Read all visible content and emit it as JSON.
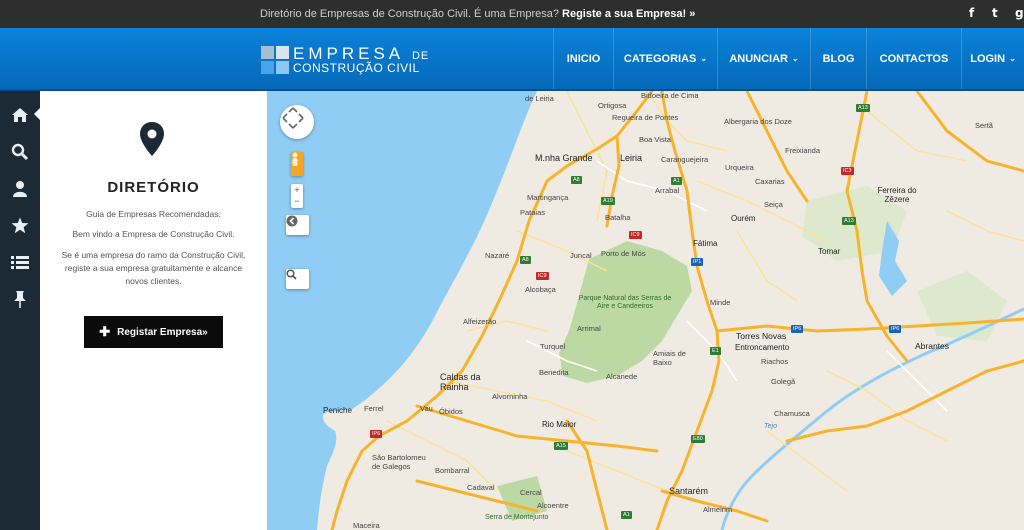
{
  "topbar": {
    "message": "Diretório de Empresas de Construção Civil.  É uma Empresa?",
    "cta": "Registe a sua Empresa! »",
    "social": {
      "facebook": "f",
      "twitter": "t",
      "google": "g"
    }
  },
  "logo": {
    "line1": "EMPRESA",
    "line1_small": "DE",
    "line2": "CONSTRUÇÃO CIVIL",
    "colors": [
      "#9fb6cc",
      "#6fb0e6",
      "#3a8fd8",
      "#d9e4ee"
    ]
  },
  "nav": [
    {
      "label": "INICIO",
      "chevron": false
    },
    {
      "label": "CATEGORIAS",
      "chevron": true
    },
    {
      "label": "ANUNCIAR",
      "chevron": true
    },
    {
      "label": "BLOG",
      "chevron": false
    },
    {
      "label": "CONTACTOS",
      "chevron": false
    },
    {
      "label": "LOGIN",
      "chevron": true
    }
  ],
  "sidebar_icons": [
    "home-icon",
    "search-icon",
    "user-icon",
    "star-icon",
    "list-icon",
    "pin-icon"
  ],
  "panel": {
    "title": "DIRETÓRIO",
    "p1": "Guia de Empresas Recomendadas.",
    "p2": "Bem vindo a Empresa de Construção Civil.",
    "p3": "Se é uma empresa do ramo da Construção Civil, registe a sua empresa gratuitamente e alcance novos clientes.",
    "button": "Registar Empresa»"
  },
  "map": {
    "zoom_in": "+",
    "zoom_out": "−",
    "labels": {
      "leiria_top": "de Leiria",
      "ortigosa": "Ortigosa",
      "regueira": "Regueira de Pontes",
      "boavista": "Boa Vista",
      "bidoeira": "Bidoeira de Cima",
      "albergaria": "Albergaria dos Doze",
      "serta": "Sertã",
      "marinha": "M.nha Grande",
      "leiria": "Leiria",
      "caranguejeira": "Caranguejeira",
      "freixianda": "Freixianda",
      "urqueira": "Urqueira",
      "caxarias": "Caxarias",
      "martingança": "Martingança",
      "arrabal": "Arrabal",
      "ferreira": "Ferreira do Zêzere",
      "pataias": "Pataias",
      "seica": "Seiça",
      "batalha": "Batalha",
      "ourem": "Ourém",
      "nazare": "Nazaré",
      "juncal": "Juncal",
      "portodemos": "Porto de Mós",
      "fatima": "Fátima",
      "tomar": "Tomar",
      "alcobaca": "Alcobaça",
      "park": "Parque Natural das Serras de Aire e Candeeiros",
      "minde": "Minde",
      "alfeizerao": "Alfeizerão",
      "arrimal": "Arrimal",
      "torresnovas": "Torres Novas",
      "turquel": "Turquel",
      "entroncamento": "Entroncamento",
      "amiais": "Amiais de Baixo",
      "abrantes": "Abrantes",
      "riachos": "Riachos",
      "caldas": "Caldas da Rainha",
      "benedita": "Benedita",
      "alcanede": "Alcanede",
      "golega": "Golegã",
      "alvorninha": "Alvorninha",
      "peniche": "Peniche",
      "ferrel": "Ferrel",
      "vau": "Vau",
      "obidos": "Óbidos",
      "chamusca": "Chamusca",
      "riomaior": "Rio Maior",
      "tejo": "Tejo",
      "saobartolomeu": "São Bartolomeu de Galegos",
      "bombarral": "Bombarral",
      "cadaval": "Cadaval",
      "santarem": "Santarém",
      "cercal": "Cercal",
      "alcoentre": "Alcoentre",
      "almeirim": "Almeirim",
      "montejunto": "Serra de Montejunto",
      "maceira": "Maceira"
    },
    "shields": [
      "A8",
      "A1",
      "A19",
      "IC9",
      "IP1",
      "A13",
      "IC3",
      "IP6",
      "E1",
      "A15",
      "E80",
      "IC2",
      "A17"
    ],
    "colors": {
      "land": "#efebe2",
      "sea": "#8fcdf5",
      "park": "#bcd9a4",
      "highway": "#f7b32b",
      "road": "#ffffff",
      "minor": "#fde293"
    }
  }
}
